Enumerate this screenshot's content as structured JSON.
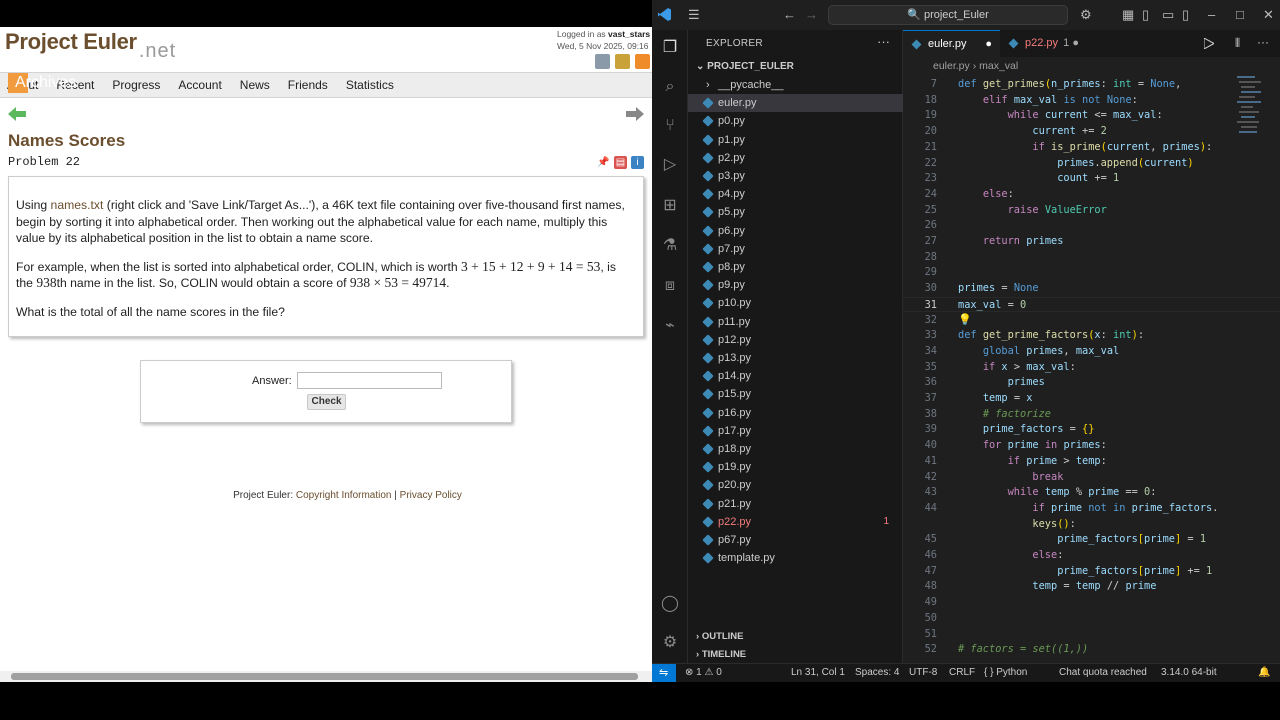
{
  "browser": {
    "logo_main": "Project Euler",
    "logo_suffix": ".net",
    "login_line1_prefix": "Logged in as ",
    "login_user": "vast_stars",
    "login_line2": "Wed, 5 Nov 2025, 09:16",
    "nav": [
      "About",
      "Archives",
      "Recent",
      "Progress",
      "Account",
      "News",
      "Friends",
      "Statistics"
    ],
    "active_nav": "Archives",
    "problem_title": "Names Scores",
    "problem_number": "Problem 22",
    "p1_a": "Using ",
    "p1_link": "names.txt",
    "p1_b": " (right click and 'Save Link/Target As...'), a 46K text file containing over five-thousand first names, begin by sorting it into alphabetical order. Then working out the alphabetical value for each name, multiply this value by its alphabetical position in the list to obtain a name score.",
    "p2_a": "For example, when the list is sorted into alphabetical order, COLIN, which is worth ",
    "p2_math1": "3 + 15 + 12 + 9 + 14 = 53",
    "p2_b": ", is the ",
    "p2_math2": "938",
    "p2_c": "th name in the list. So, COLIN would obtain a score of ",
    "p2_math3": "938 × 53 = 49714",
    "p2_d": ".",
    "p3": "What is the total of all the name scores in the file?",
    "answer_label": "Answer:",
    "check_label": "Check",
    "footer_prefix": "Project Euler: ",
    "footer_copyright": "Copyright Information",
    "footer_sep": " | ",
    "footer_privacy": "Privacy Policy"
  },
  "vscode": {
    "search_text": "project_Euler",
    "explorer_title": "EXPLORER",
    "project_name": "PROJECT_EULER",
    "files": [
      {
        "name": "__pycache__",
        "type": "folder"
      },
      {
        "name": "euler.py",
        "type": "py",
        "selected": true
      },
      {
        "name": "p0.py",
        "type": "py"
      },
      {
        "name": "p1.py",
        "type": "py"
      },
      {
        "name": "p2.py",
        "type": "py"
      },
      {
        "name": "p3.py",
        "type": "py"
      },
      {
        "name": "p4.py",
        "type": "py"
      },
      {
        "name": "p5.py",
        "type": "py"
      },
      {
        "name": "p6.py",
        "type": "py"
      },
      {
        "name": "p7.py",
        "type": "py"
      },
      {
        "name": "p8.py",
        "type": "py"
      },
      {
        "name": "p9.py",
        "type": "py"
      },
      {
        "name": "p10.py",
        "type": "py"
      },
      {
        "name": "p11.py",
        "type": "py"
      },
      {
        "name": "p12.py",
        "type": "py"
      },
      {
        "name": "p13.py",
        "type": "py"
      },
      {
        "name": "p14.py",
        "type": "py"
      },
      {
        "name": "p15.py",
        "type": "py"
      },
      {
        "name": "p16.py",
        "type": "py"
      },
      {
        "name": "p17.py",
        "type": "py"
      },
      {
        "name": "p18.py",
        "type": "py"
      },
      {
        "name": "p19.py",
        "type": "py"
      },
      {
        "name": "p20.py",
        "type": "py"
      },
      {
        "name": "p21.py",
        "type": "py"
      },
      {
        "name": "p22.py",
        "type": "py",
        "error": true,
        "count": "1"
      },
      {
        "name": "p67.py",
        "type": "py"
      },
      {
        "name": "template.py",
        "type": "py"
      }
    ],
    "outline_label": "OUTLINE",
    "timeline_label": "TIMELINE",
    "tabs": [
      {
        "label": "euler.py",
        "active": true,
        "marker": "●"
      },
      {
        "label": "p22.py",
        "active": false,
        "marker": "1 ●"
      }
    ],
    "breadcrumb": [
      "euler.py",
      "max_val"
    ],
    "code_lines": [
      [
        "7",
        "<span class='k'>def</span> <span class='fn'>get_primes</span><span class='p'>(</span><span class='v'>n_primes</span>: <span class='t'>int</span> = <span class='k'>None</span>,"
      ],
      [
        "18",
        "    <span class='kf'>elif</span> <span class='v'>max_val</span> <span class='k'>is not</span> <span class='k'>None</span>:"
      ],
      [
        "19",
        "        <span class='kf'>while</span> <span class='v'>current</span> &lt;= <span class='v'>max_val</span>:"
      ],
      [
        "20",
        "            <span class='v'>current</span> += <span class='n'>2</span>"
      ],
      [
        "21",
        "            <span class='kf'>if</span> <span class='fn'>is_prime</span><span class='p'>(</span><span class='v'>current</span>, <span class='v'>primes</span><span class='p'>)</span>:"
      ],
      [
        "22",
        "                <span class='v'>primes</span>.<span class='fn'>append</span><span class='p'>(</span><span class='v'>current</span><span class='p'>)</span>"
      ],
      [
        "23",
        "                <span class='v'>count</span> += <span class='n'>1</span>"
      ],
      [
        "24",
        "    <span class='kf'>else</span>:"
      ],
      [
        "25",
        "        <span class='kf'>raise</span> <span class='t'>ValueError</span>"
      ],
      [
        "26",
        ""
      ],
      [
        "27",
        "    <span class='kf'>return</span> <span class='v'>primes</span>"
      ],
      [
        "28",
        ""
      ],
      [
        "29",
        ""
      ],
      [
        "30",
        "<span class='v'>primes</span> = <span class='k'>None</span>"
      ],
      [
        "31",
        "<span class='v'>max_val</span> = <span class='n'>0</span>"
      ],
      [
        "32",
        ""
      ],
      [
        "33",
        "<span class='k'>def</span> <span class='fn'>get_prime_factors</span><span class='p'>(</span><span class='v'>x</span>: <span class='t'>int</span><span class='p'>)</span>:"
      ],
      [
        "34",
        "    <span class='k'>global</span> <span class='v'>primes</span>, <span class='v'>max_val</span>"
      ],
      [
        "35",
        "    <span class='kf'>if</span> <span class='v'>x</span> &gt; <span class='v'>max_val</span>:"
      ],
      [
        "36",
        "        <span class='v'>primes</span>"
      ],
      [
        "37",
        "    <span class='v'>temp</span> = <span class='v'>x</span>"
      ],
      [
        "38",
        "    <span class='cm'># factorize</span>"
      ],
      [
        "39",
        "    <span class='v'>prime_factors</span> = <span class='p'>{}</span>"
      ],
      [
        "40",
        "    <span class='kf'>for</span> <span class='v'>prime</span> <span class='kf'>in</span> <span class='v'>primes</span>:"
      ],
      [
        "41",
        "        <span class='kf'>if</span> <span class='v'>prime</span> &gt; <span class='v'>temp</span>:"
      ],
      [
        "42",
        "            <span class='kf'>break</span>"
      ],
      [
        "43",
        "        <span class='kf'>while</span> <span class='v'>temp</span> % <span class='v'>prime</span> == <span class='n'>0</span>:"
      ],
      [
        "44",
        "            <span class='kf'>if</span> <span class='v'>prime</span> <span class='k'>not in</span> <span class='v'>prime_factors</span>."
      ],
      [
        "",
        "            <span class='fn'>keys</span><span class='p'>()</span>:"
      ],
      [
        "45",
        "                <span class='v'>prime_factors</span><span class='p'>[</span><span class='v'>prime</span><span class='p'>]</span> = <span class='n'>1</span>"
      ],
      [
        "46",
        "            <span class='kf'>else</span>:"
      ],
      [
        "47",
        "                <span class='v'>prime_factors</span><span class='p'>[</span><span class='v'>prime</span><span class='p'>]</span> += <span class='n'>1</span>"
      ],
      [
        "48",
        "            <span class='v'>temp</span> = <span class='v'>temp</span> // <span class='v'>prime</span>"
      ],
      [
        "49",
        ""
      ],
      [
        "50",
        ""
      ],
      [
        "51",
        ""
      ],
      [
        "52",
        "<span class='cm'># factors = set((1,))</span>"
      ]
    ],
    "current_line": "31",
    "status": {
      "problems": "⊗ 1 ⚠ 0",
      "position": "Ln 31, Col 1",
      "spaces": "Spaces: 4",
      "encoding": "UTF-8",
      "eol": "CRLF",
      "language": "{ } Python",
      "chat": "Chat quota reached",
      "interpreter": "3.14.0 64-bit"
    }
  },
  "colors": {
    "accent": "#0078d4",
    "archives": "#f19a3e",
    "pe_brown": "#6b4e2e"
  }
}
